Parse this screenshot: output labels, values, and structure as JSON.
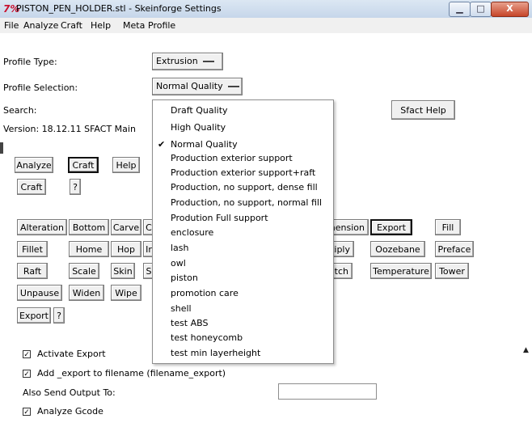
{
  "window": {
    "title": "PISTON_PEN_HOLDER.stl - Skeinforge Settings",
    "app_icon_glyph": "7%",
    "minimize_glyph": "▁",
    "maximize_glyph": "□",
    "close_glyph": "X"
  },
  "menubar": [
    "File",
    "Analyze",
    "Craft",
    "Help",
    "Meta",
    "Profile"
  ],
  "profile": {
    "type_label": "Profile Type:",
    "type_value": "Extrusion",
    "selection_label": "Profile Selection:",
    "selection_value": "Normal Quality",
    "search_label": "Search:",
    "version_text": "Version: 18.12.11  SFACT Main",
    "sfact_help": "Sfact Help"
  },
  "dropdown": {
    "options": [
      "Draft Quality",
      "High Quality",
      "Normal Quality",
      "Production exterior support",
      "Production exterior support+raft",
      "Production, no support, dense fill",
      "Production, no support, normal fill",
      "Prodution Full support",
      "enclosure",
      "lash",
      "owl",
      "piston",
      "promotion care",
      "shell",
      "test ABS",
      "test honeycomb",
      "test min layerheight"
    ],
    "checked_index": 2,
    "check_glyph": "✔"
  },
  "top_tabs": {
    "analyze": "Analyze",
    "craft": "Craft",
    "help": "Help"
  },
  "craft_row": {
    "craft": "Craft",
    "help": "?"
  },
  "plugins": {
    "alteration": "Alteration",
    "bottom": "Bottom",
    "carve": "Carve",
    "c_partial": "C",
    "dimension_partial": "nension",
    "export": "Export",
    "fill": "Fill",
    "fillet": "Fillet",
    "home": "Home",
    "hop": "Hop",
    "i_partial": "Ir",
    "multiply_partial": "ltiply",
    "oozebane": "Oozebane",
    "preface": "Preface",
    "raft": "Raft",
    "scale": "Scale",
    "skin": "Skin",
    "s_partial": "S",
    "stretch_partial": "tch",
    "temperature": "Temperature",
    "tower": "Tower",
    "unpause": "Unpause",
    "widen": "Widen",
    "wipe": "Wipe"
  },
  "export_row": {
    "export": "Export",
    "help": "?"
  },
  "settings": {
    "activate_export": {
      "label": "Activate Export",
      "checked": true
    },
    "add_export_suffix": {
      "label": "Add _export to filename (filename_export)",
      "checked": true
    },
    "also_send_label": "Also Send Output To:",
    "also_send_value": "",
    "analyze_gcode": {
      "label": "Analyze Gcode",
      "checked": true
    },
    "check_mark": "✓"
  },
  "scrollbar": {
    "up_arrow": "▲"
  }
}
